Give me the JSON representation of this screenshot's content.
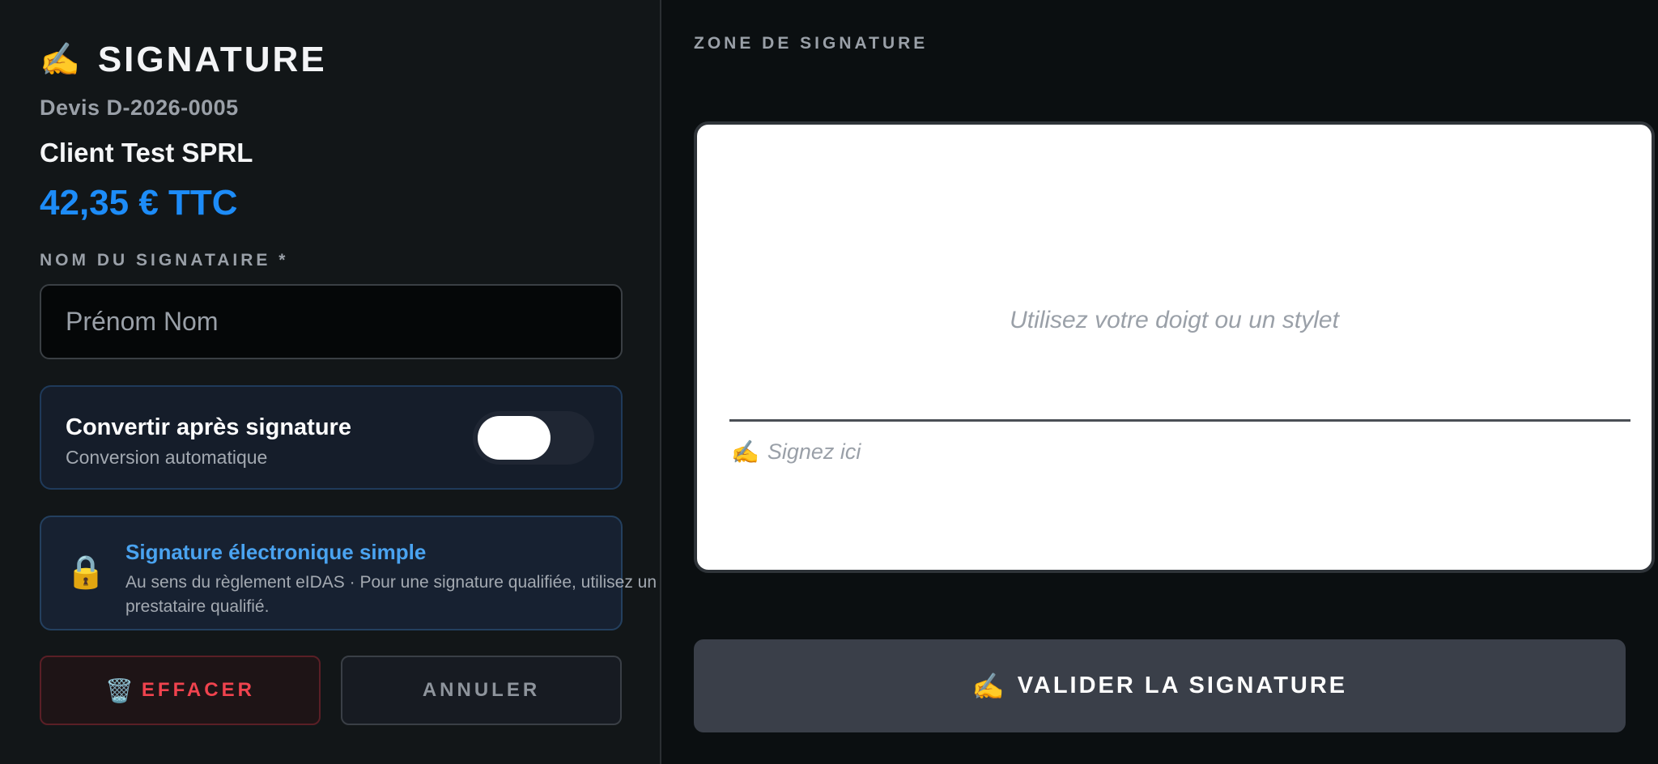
{
  "header": {
    "icon": "writing-hand-icon",
    "icon_glyph": "✍️",
    "title": "SIGNATURE"
  },
  "quote": {
    "number": "Devis D-2026-0005",
    "client": "Client Test SPRL",
    "amount": "42,35 € TTC"
  },
  "signer_field": {
    "label": "NOM DU SIGNATAIRE *",
    "placeholder": "Prénom Nom",
    "value": ""
  },
  "convert": {
    "title": "Convertir après signature",
    "subtitle": "Conversion automatique",
    "toggle_on": false
  },
  "info": {
    "icon": "lock-icon",
    "icon_glyph": "🔒",
    "title": "Signature électronique simple",
    "text": "Au sens du règlement eIDAS · Pour une signature qualifiée, utilisez un prestataire qualifié."
  },
  "buttons": {
    "clear_icon": "trash-icon",
    "clear_icon_glyph": "🗑️",
    "clear_label": "EFFACER",
    "cancel_label": "ANNULER",
    "validate_icon": "writing-hand-icon",
    "validate_icon_glyph": "✍️",
    "validate_label": "VALIDER LA SIGNATURE"
  },
  "signature_zone": {
    "label": "ZONE DE SIGNATURE",
    "hint": "Utilisez votre doigt ou un stylet",
    "sign_here_icon": "writing-hand-icon",
    "sign_here_icon_glyph": "✍️",
    "sign_here": "Signez ici"
  },
  "colors": {
    "accent_blue": "#1d8cf8",
    "danger_red": "#f0434e",
    "info_blue": "#4aa3f0"
  }
}
